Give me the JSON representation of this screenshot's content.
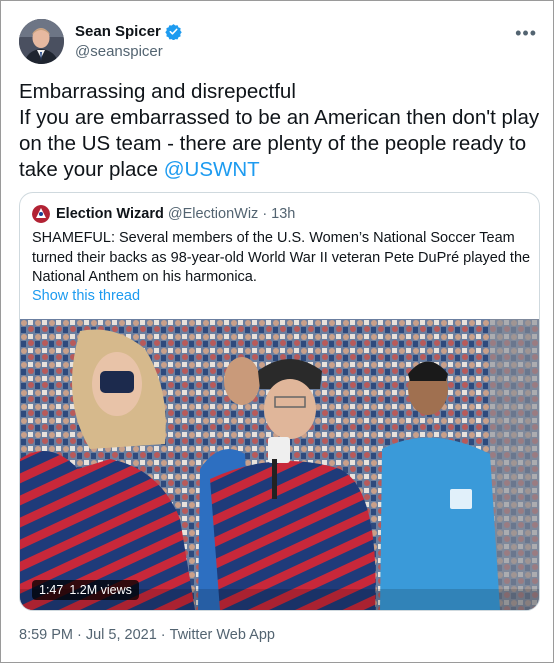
{
  "author": {
    "name": "Sean Spicer",
    "handle": "@seanspicer",
    "verified": true
  },
  "tweet": {
    "lines": [
      "Embarrassing and disrepectful",
      "If you are embarrassed to be an American then don't play",
      "on the US team - there are plenty of the people ready to",
      "take your place"
    ],
    "mention": "@USWNT"
  },
  "quoted": {
    "name": "Election Wizard",
    "handle": "@ElectionWiz",
    "dot": "·",
    "time": "13h",
    "lines": [
      "SHAMEFUL: Several members of the U.S. Women’s National Soccer Team",
      "turned their backs as 98-year-old World War II veteran Pete DuPré played the",
      "National Anthem on his harmonica."
    ],
    "show_thread": "Show this thread",
    "video": {
      "duration": "1:47",
      "views": "1.2M views"
    }
  },
  "footer": {
    "time": "8:59 PM",
    "date": "Jul 5, 2021",
    "source": "Twitter Web App",
    "sep": "·"
  },
  "colors": {
    "link": "#1d9bf0",
    "secondary": "#536471",
    "border": "#cfd9de"
  },
  "icons": [
    "verified-badge-icon",
    "more-options-icon",
    "election-wizard-avatar-icon"
  ]
}
